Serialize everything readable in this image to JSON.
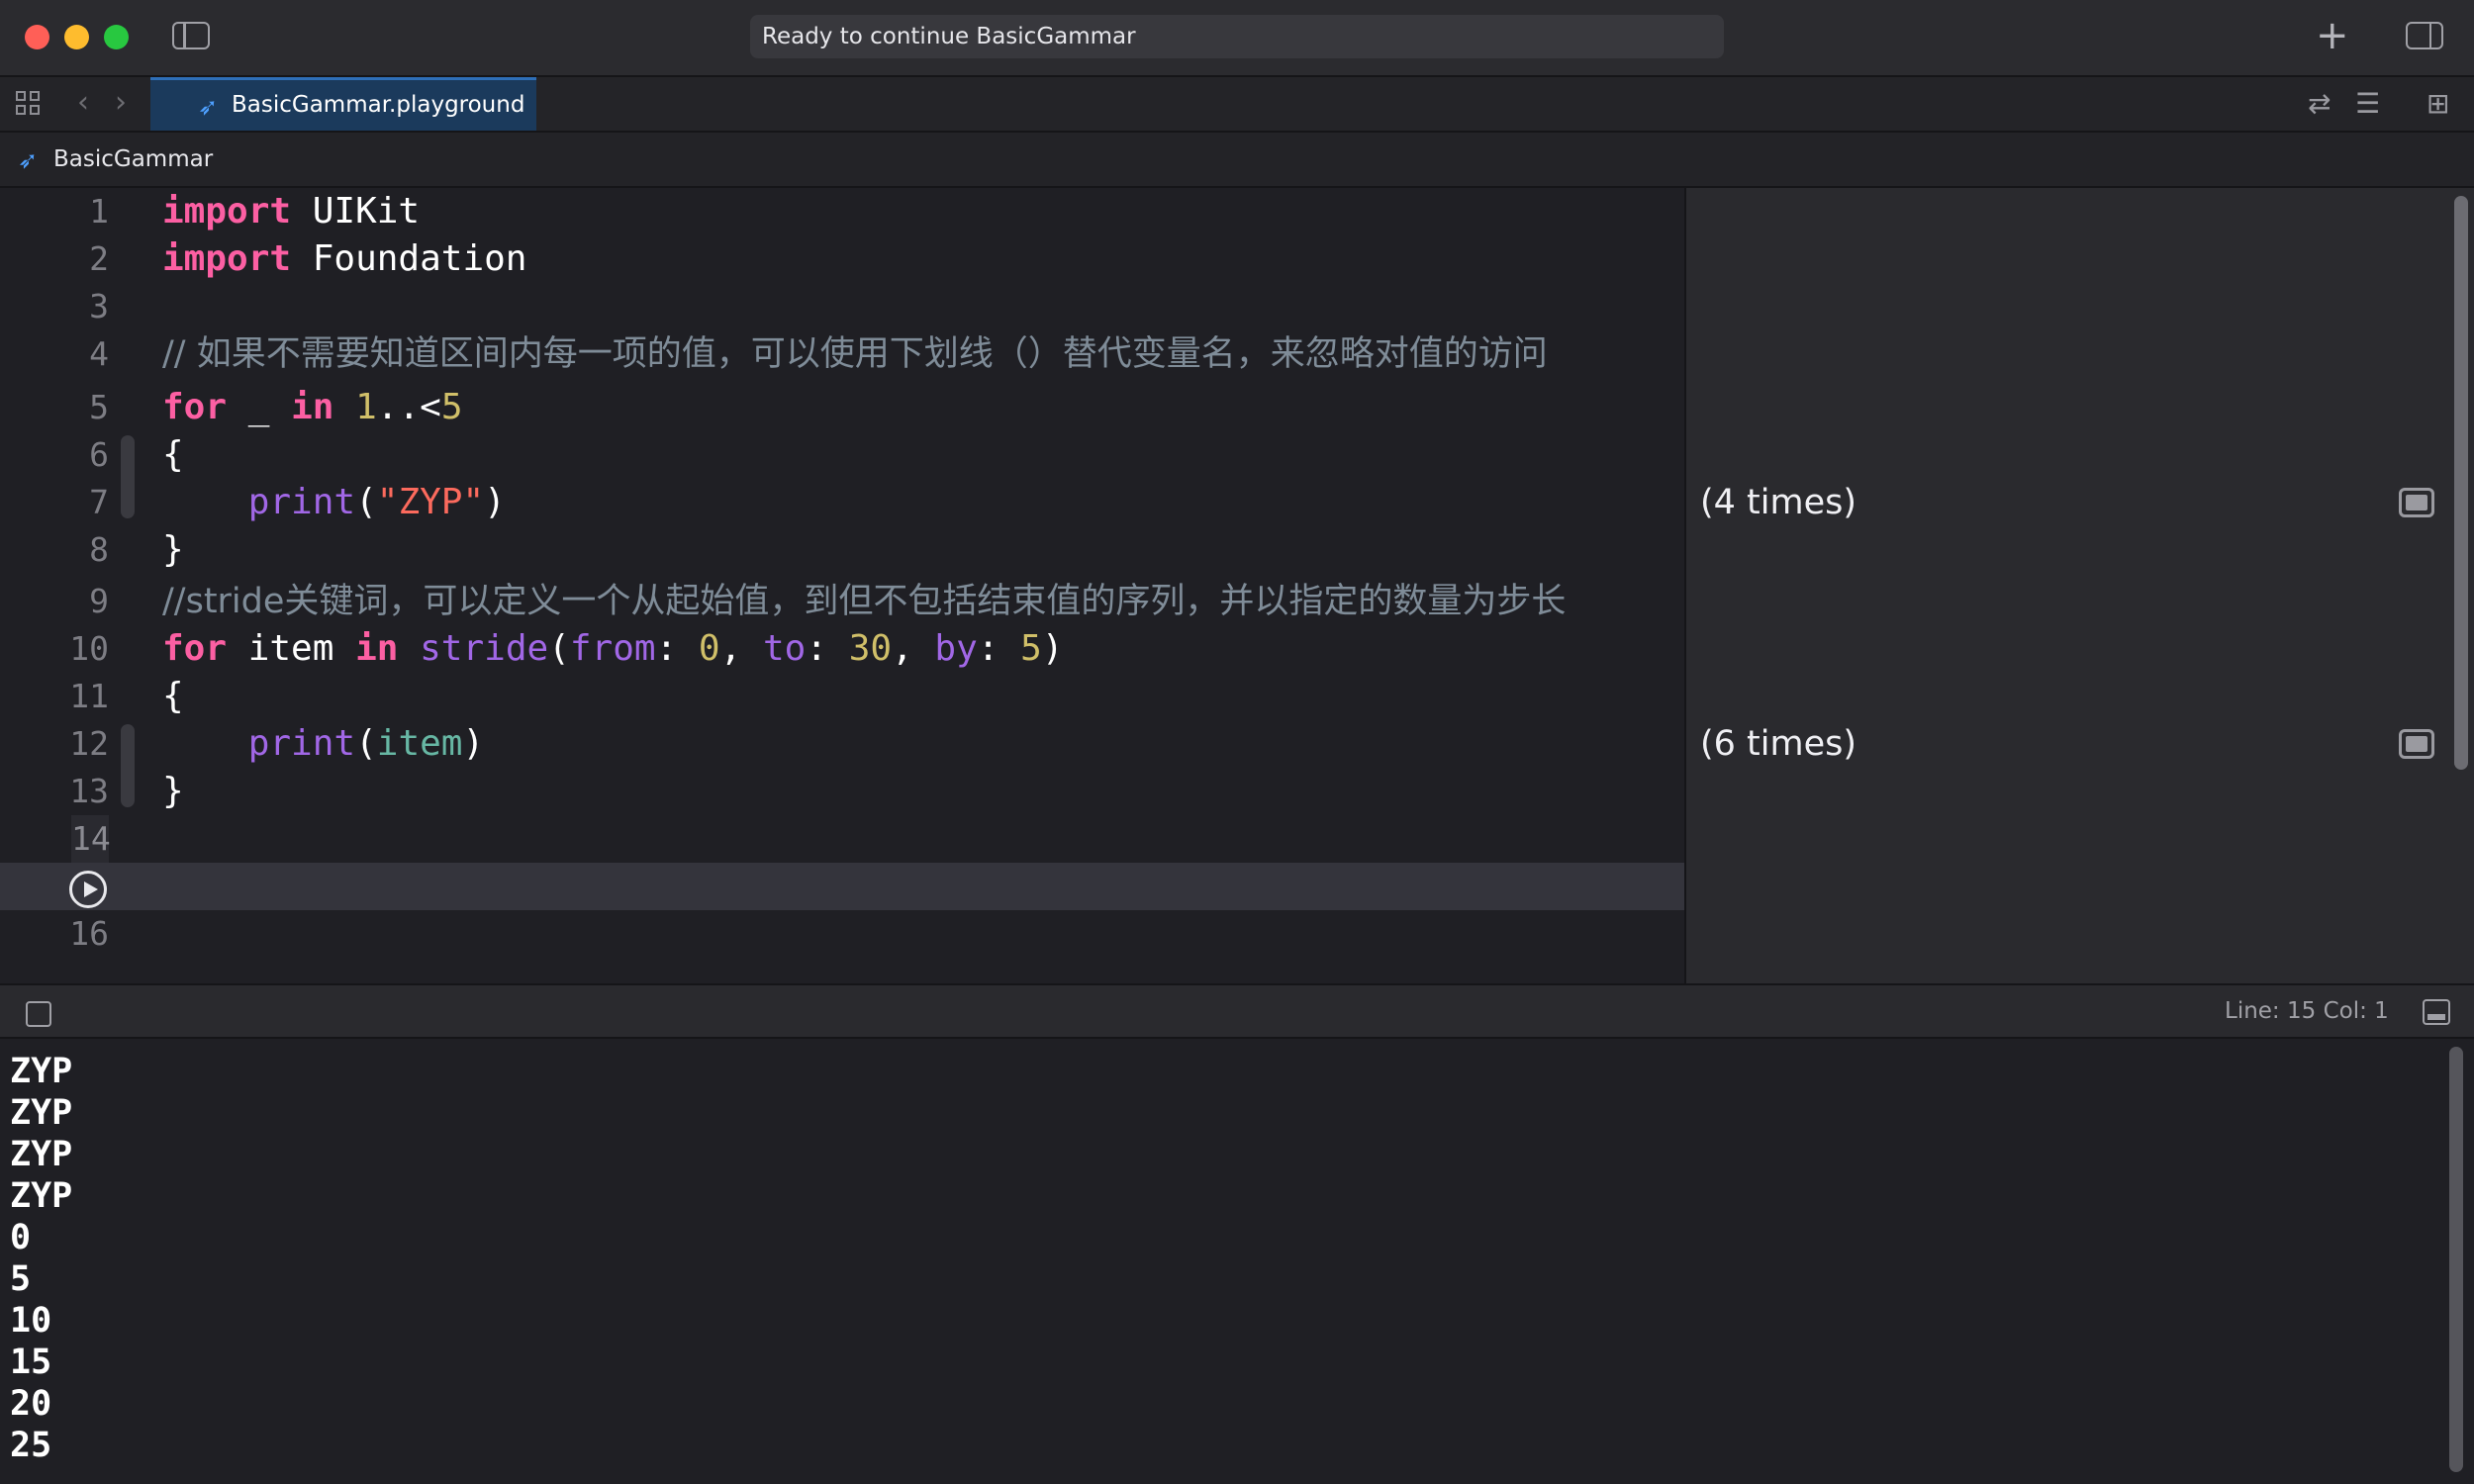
{
  "window": {
    "activity_status": "Ready to continue BasicGammar",
    "plus_glyph": "+"
  },
  "tabs": [
    {
      "label": "BasicGammar.playground",
      "icon": "swift-icon",
      "active": true
    }
  ],
  "breadcrumb": {
    "label": "BasicGammar",
    "icon": "swift-icon"
  },
  "editor": {
    "current_line": 15,
    "lines": [
      {
        "num": "1",
        "tokens": [
          [
            "kw",
            "import"
          ],
          [
            "pl",
            " UIKit"
          ]
        ]
      },
      {
        "num": "2",
        "tokens": [
          [
            "kw",
            "import"
          ],
          [
            "pl",
            " Foundation"
          ]
        ]
      },
      {
        "num": "3",
        "tokens": []
      },
      {
        "num": "4",
        "tokens": [
          [
            "cmt",
            "// 如果不需要知道区间内每一项的值，可以使用下划线（）替代变量名，来忽略对值的访问"
          ]
        ]
      },
      {
        "num": "5",
        "tokens": [
          [
            "kw",
            "for"
          ],
          [
            "pl",
            " _ "
          ],
          [
            "kw",
            "in"
          ],
          [
            "pl",
            " "
          ],
          [
            "num",
            "1"
          ],
          [
            "pl",
            "..<"
          ],
          [
            "num",
            "5"
          ]
        ]
      },
      {
        "num": "6",
        "tokens": [
          [
            "pl",
            "{"
          ]
        ]
      },
      {
        "num": "7",
        "tokens": [
          [
            "pl",
            "    "
          ],
          [
            "fn",
            "print"
          ],
          [
            "pl",
            "("
          ],
          [
            "str",
            "\"ZYP\""
          ],
          [
            "pl",
            ")"
          ]
        ]
      },
      {
        "num": "8",
        "tokens": [
          [
            "pl",
            "}"
          ]
        ]
      },
      {
        "num": "9",
        "tokens": [
          [
            "cmt",
            "//stride关键词，可以定义一个从起始值，到但不包括结束值的序列，并以指定的数量为步长"
          ]
        ]
      },
      {
        "num": "10",
        "tokens": [
          [
            "kw",
            "for"
          ],
          [
            "pl",
            " item "
          ],
          [
            "kw",
            "in"
          ],
          [
            "pl",
            " "
          ],
          [
            "fn",
            "stride"
          ],
          [
            "pl",
            "("
          ],
          [
            "fn",
            "from"
          ],
          [
            "pl",
            ": "
          ],
          [
            "num",
            "0"
          ],
          [
            "pl",
            ", "
          ],
          [
            "fn",
            "to"
          ],
          [
            "pl",
            ": "
          ],
          [
            "num",
            "30"
          ],
          [
            "pl",
            ", "
          ],
          [
            "fn",
            "by"
          ],
          [
            "pl",
            ": "
          ],
          [
            "num",
            "5"
          ],
          [
            "pl",
            ")"
          ]
        ]
      },
      {
        "num": "11",
        "tokens": [
          [
            "pl",
            "{"
          ]
        ]
      },
      {
        "num": "12",
        "tokens": [
          [
            "pl",
            "    "
          ],
          [
            "fn",
            "print"
          ],
          [
            "pl",
            "("
          ],
          [
            "var",
            "item"
          ],
          [
            "pl",
            ")"
          ]
        ]
      },
      {
        "num": "13",
        "tokens": [
          [
            "pl",
            "}"
          ]
        ]
      },
      {
        "num": "14",
        "tokens": []
      },
      {
        "num": "",
        "tokens": [],
        "run_button": true
      },
      {
        "num": "16",
        "tokens": []
      }
    ]
  },
  "results": [
    {
      "line": 7,
      "text": "(4 times)"
    },
    {
      "line": 12,
      "text": "(6 times)"
    }
  ],
  "debug": {
    "cursor_position": "Line: 15  Col: 1"
  },
  "console": {
    "output": [
      "ZYP",
      "ZYP",
      "ZYP",
      "ZYP",
      "0",
      "5",
      "10",
      "15",
      "20",
      "25"
    ]
  },
  "colors": {
    "keyword": "#fc5fa3",
    "number": "#d0bf69",
    "string": "#fc6a5d",
    "function": "#a167e6",
    "variable": "#67b7a4",
    "comment": "#7f8c98",
    "tab_active": "#1b3a5c"
  }
}
